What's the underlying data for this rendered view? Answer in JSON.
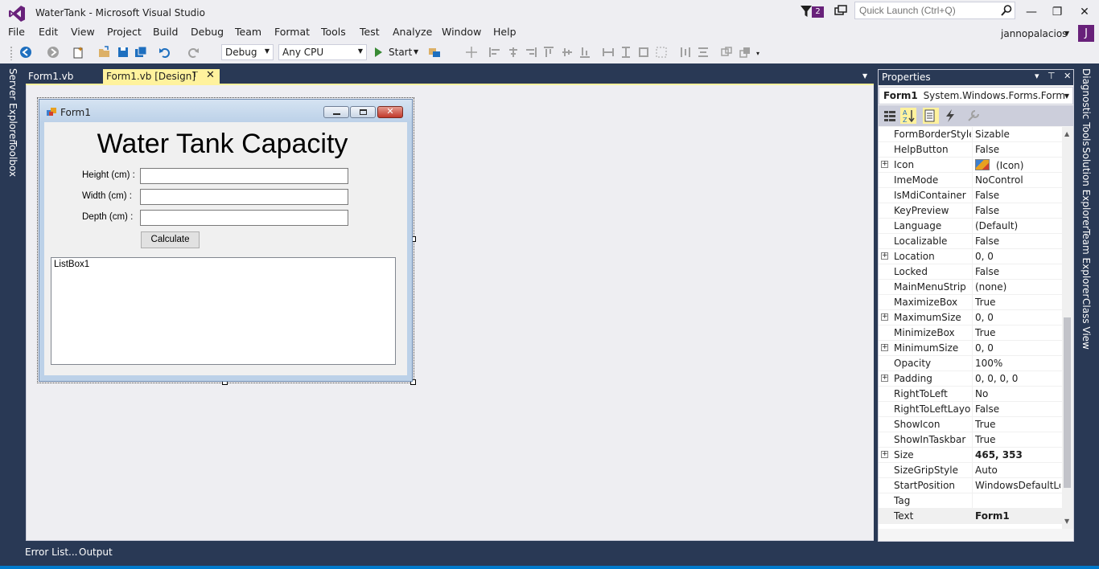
{
  "window": {
    "title": "WaterTank - Microsoft Visual Studio",
    "notification_count": "2",
    "quick_launch_placeholder": "Quick Launch (Ctrl+Q)",
    "minimize": "—",
    "maximize": "❐",
    "close": "✕"
  },
  "menu": {
    "items": [
      "File",
      "Edit",
      "View",
      "Project",
      "Build",
      "Debug",
      "Team",
      "Format",
      "Tools",
      "Test",
      "Analyze",
      "Window",
      "Help"
    ]
  },
  "user": {
    "name": "jannopalacios",
    "avatar_letter": "J"
  },
  "toolbar": {
    "config": "Debug",
    "platform": "Any CPU",
    "start": "Start"
  },
  "side_tabs": {
    "left": [
      "Server Explorer",
      "Toolbox"
    ],
    "right": [
      "Diagnostic Tools",
      "Solution Explorer",
      "Team Explorer",
      "Class View"
    ]
  },
  "doc_tabs": {
    "code": "Form1.vb",
    "design": "Form1.vb [Design]",
    "pin": "⊤",
    "close": "✕"
  },
  "form": {
    "title": "Form1",
    "heading": "Water Tank Capacity",
    "labels": [
      "Height (cm) :",
      "Width (cm) :",
      "Depth (cm) :"
    ],
    "button": "Calculate",
    "listbox": "ListBox1"
  },
  "bottom_tabs": [
    "Error List...",
    "Output"
  ],
  "properties": {
    "header": "Properties",
    "object_name": "Form1",
    "object_type": "System.Windows.Forms.Form",
    "rows": [
      {
        "name": "FormBorderStyle",
        "value": "Sizable",
        "expandable": false,
        "bold": false
      },
      {
        "name": "HelpButton",
        "value": "False",
        "expandable": false,
        "bold": false
      },
      {
        "name": "Icon",
        "value": "(Icon)",
        "expandable": true,
        "bold": false
      },
      {
        "name": "ImeMode",
        "value": "NoControl",
        "expandable": false,
        "bold": false
      },
      {
        "name": "IsMdiContainer",
        "value": "False",
        "expandable": false,
        "bold": false
      },
      {
        "name": "KeyPreview",
        "value": "False",
        "expandable": false,
        "bold": false
      },
      {
        "name": "Language",
        "value": "(Default)",
        "expandable": false,
        "bold": false
      },
      {
        "name": "Localizable",
        "value": "False",
        "expandable": false,
        "bold": false
      },
      {
        "name": "Location",
        "value": "0, 0",
        "expandable": true,
        "bold": false
      },
      {
        "name": "Locked",
        "value": "False",
        "expandable": false,
        "bold": false
      },
      {
        "name": "MainMenuStrip",
        "value": "(none)",
        "expandable": false,
        "bold": false
      },
      {
        "name": "MaximizeBox",
        "value": "True",
        "expandable": false,
        "bold": false
      },
      {
        "name": "MaximumSize",
        "value": "0, 0",
        "expandable": true,
        "bold": false
      },
      {
        "name": "MinimizeBox",
        "value": "True",
        "expandable": false,
        "bold": false
      },
      {
        "name": "MinimumSize",
        "value": "0, 0",
        "expandable": true,
        "bold": false
      },
      {
        "name": "Opacity",
        "value": "100%",
        "expandable": false,
        "bold": false
      },
      {
        "name": "Padding",
        "value": "0, 0, 0, 0",
        "expandable": true,
        "bold": false
      },
      {
        "name": "RightToLeft",
        "value": "No",
        "expandable": false,
        "bold": false
      },
      {
        "name": "RightToLeftLayout",
        "value": "False",
        "expandable": false,
        "bold": false
      },
      {
        "name": "ShowIcon",
        "value": "True",
        "expandable": false,
        "bold": false
      },
      {
        "name": "ShowInTaskbar",
        "value": "True",
        "expandable": false,
        "bold": false
      },
      {
        "name": "Size",
        "value": "465, 353",
        "expandable": true,
        "bold": true
      },
      {
        "name": "SizeGripStyle",
        "value": "Auto",
        "expandable": false,
        "bold": false
      },
      {
        "name": "StartPosition",
        "value": "WindowsDefaultLocation",
        "expandable": false,
        "bold": false
      },
      {
        "name": "Tag",
        "value": "",
        "expandable": false,
        "bold": false
      },
      {
        "name": "Text",
        "value": "Form1",
        "expandable": false,
        "bold": true
      }
    ]
  },
  "colors": {
    "accent": "#68217a",
    "chrome": "#eeeef2",
    "dark": "#293955",
    "active_tab": "#fff29d",
    "status": "#007acc"
  }
}
